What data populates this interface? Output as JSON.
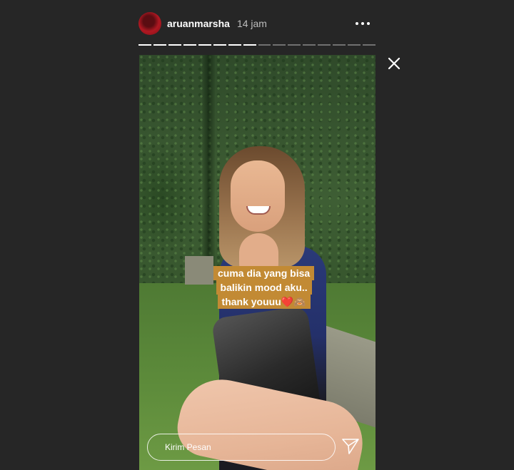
{
  "header": {
    "username": "aruanmarsha",
    "time": "14 jam"
  },
  "progress": {
    "total": 16,
    "completed": 8
  },
  "story": {
    "caption_lines": [
      "cuma dia yang bisa",
      "balikin mood aku..",
      "thank youuu❤️🙈"
    ]
  },
  "reply": {
    "placeholder": "Kirim Pesan"
  },
  "icons": {
    "more": "more-options-icon",
    "close": "close-icon",
    "send": "send-icon"
  },
  "colors": {
    "background": "#262626",
    "caption_bg": "#c28a34",
    "avatar": "#b01822"
  }
}
